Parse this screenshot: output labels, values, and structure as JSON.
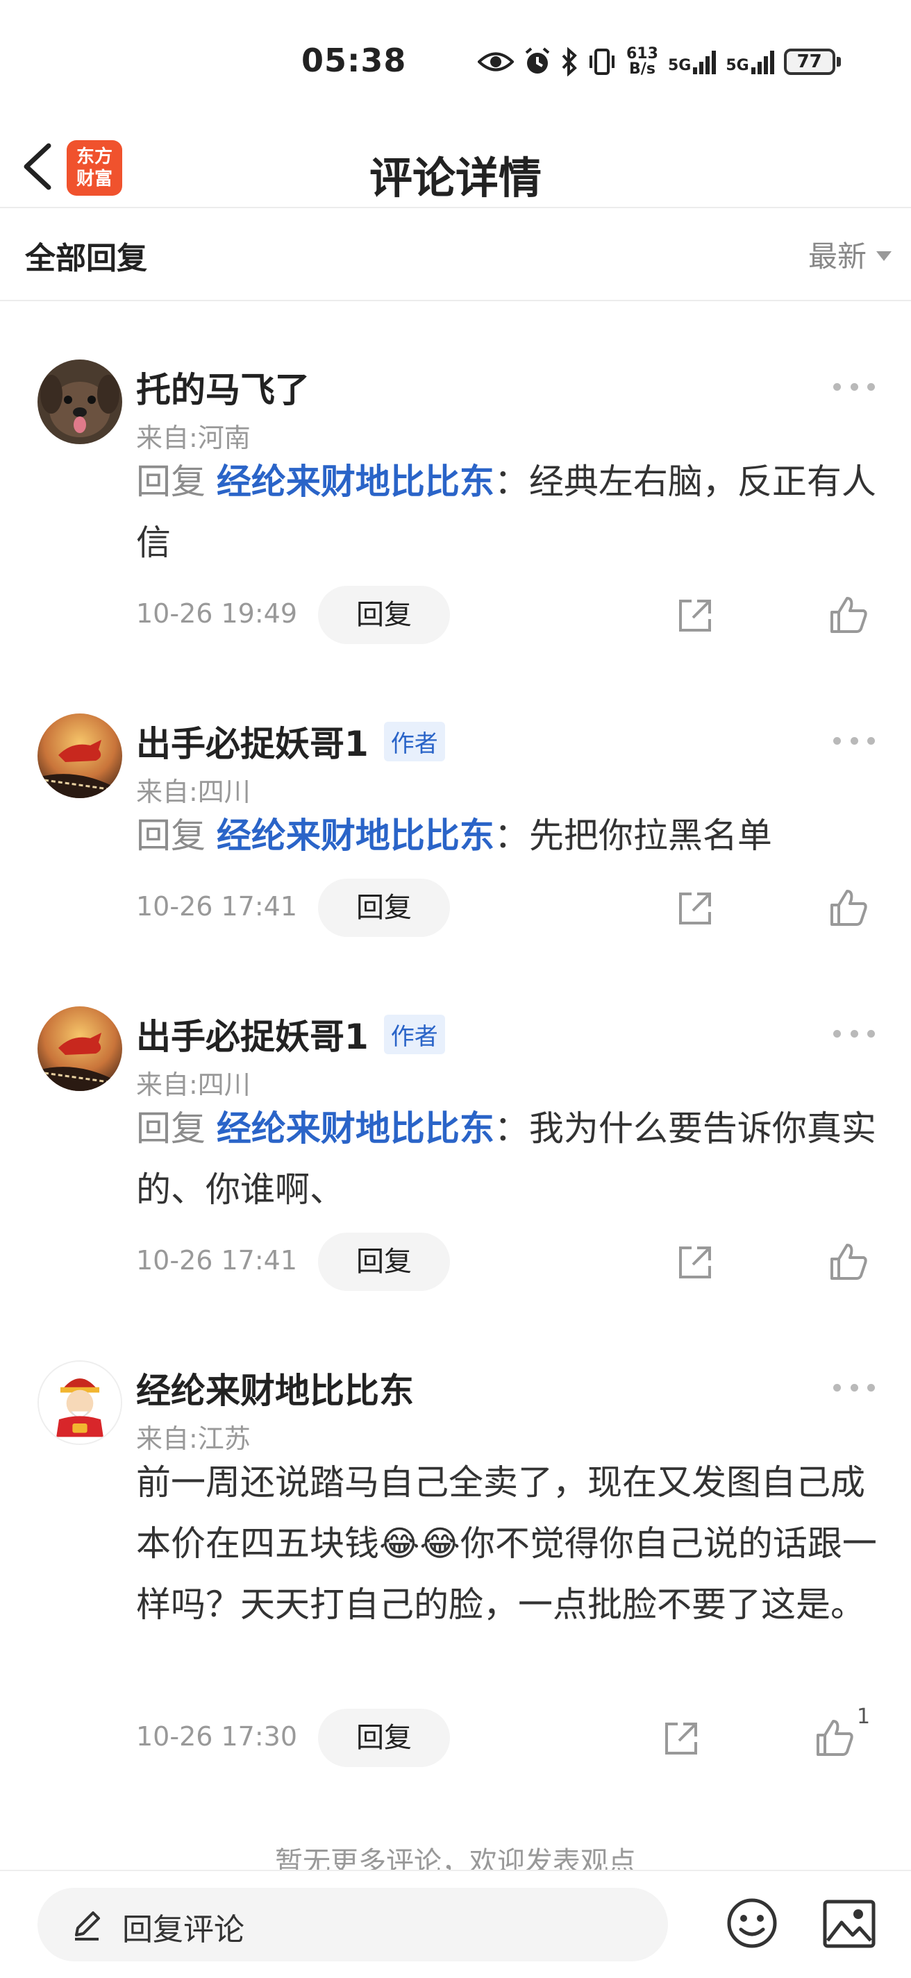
{
  "status_bar": {
    "time": "05:38",
    "net_speed_top": "613",
    "net_speed_bottom": "B/s",
    "signal1": "5G",
    "signal2": "5G",
    "battery": "77"
  },
  "header": {
    "logo_line1": "东方",
    "logo_line2": "财富",
    "title": "评论详情"
  },
  "subbar": {
    "left_label": "全部回复",
    "sort_label": "最新"
  },
  "comments": [
    {
      "name": "托的马飞了",
      "is_author": false,
      "location": "来自:河南",
      "reply_prefix": "回复",
      "reply_to": "经纶来财地比比东",
      "separator": "：",
      "text": "经典左右脑，反正有人信",
      "time": "10-26 19:49",
      "reply_button": "回复",
      "likes": ""
    },
    {
      "name": "出手必捉妖哥1",
      "is_author": true,
      "author_tag": "作者",
      "location": "来自:四川",
      "reply_prefix": "回复",
      "reply_to": "经纶来财地比比东",
      "separator": "：",
      "text": "先把你拉黑名单",
      "time": "10-26 17:41",
      "reply_button": "回复",
      "likes": ""
    },
    {
      "name": "出手必捉妖哥1",
      "is_author": true,
      "author_tag": "作者",
      "location": "来自:四川",
      "reply_prefix": "回复",
      "reply_to": "经纶来财地比比东",
      "separator": "：",
      "text": "我为什么要告诉你真实的、你谁啊、",
      "time": "10-26 17:41",
      "reply_button": "回复",
      "likes": ""
    },
    {
      "name": "经纶来财地比比东",
      "is_author": false,
      "location": "来自:江苏",
      "text_part1": "前一周还说踏马自己全卖了，现在又发图自己成本价在四五块钱",
      "emoji": "😂😂",
      "text_part2": "你不觉得你自己说的话跟一样吗？天天打自己的脸，一点批脸不要了这是。",
      "time": "10-26 17:30",
      "reply_button": "回复",
      "likes": "1"
    }
  ],
  "no_more_text": "暂无更多评论，欢迎发表观点",
  "bottom_bar": {
    "input_placeholder": "回复评论"
  },
  "colors": {
    "accent_blue": "#2a64c8",
    "brand_orange": "#f0522d",
    "muted_gray": "#999999"
  },
  "icons": [
    "back-icon",
    "eye-icon",
    "alarm-icon",
    "bluetooth-icon",
    "vibrate-icon",
    "signal-icon",
    "battery-icon",
    "more-icon",
    "share-icon",
    "like-icon",
    "pen-icon",
    "emoji-icon",
    "image-icon"
  ]
}
